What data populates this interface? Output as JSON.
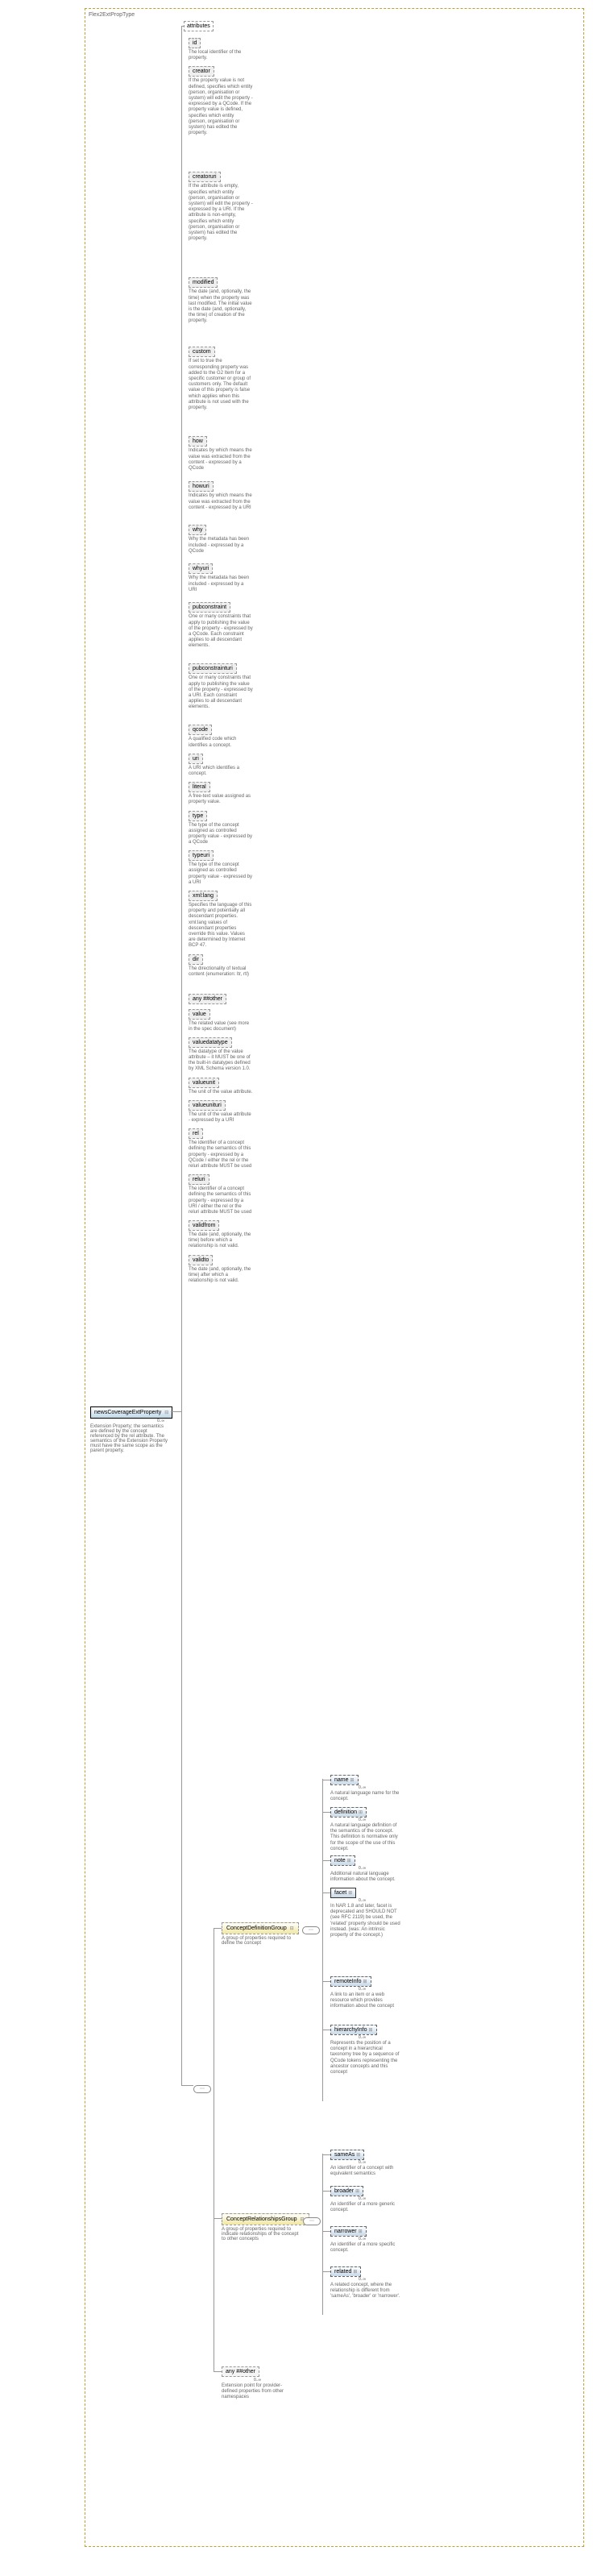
{
  "outer_title": "Flex2ExtPropType",
  "root": {
    "label": "newsCoverageExtProperty",
    "occ": "0..∞"
  },
  "root_note": "Extension Property; the semantics are defined by the concept referenced by the rel attribute. The semantics of the Extension Property must have the same scope as the parent property.",
  "attributes_label": "attributes",
  "attrs": [
    {
      "name": "id",
      "desc": "The local identifier of the property."
    },
    {
      "name": "creator",
      "desc": "If the property value is not defined, specifies which entity (person, organisation or system) will edit the property - expressed by a QCode. If the property value is defined, specifies which entity (person, organisation or system) has edited the property."
    },
    {
      "name": "creatoruri",
      "desc": "If the attribute is empty, specifies which entity (person, organisation or system) will edit the property - expressed by a URI. If the attribute is non-empty, specifies which entity (person, organisation or system) has edited the property."
    },
    {
      "name": "modified",
      "desc": "The date (and, optionally, the time) when the property was last modified. The initial value is the date (and, optionally, the time) of creation of the property."
    },
    {
      "name": "custom",
      "desc": "If set to true the corresponding property was added to the G2 Item for a specific customer or group of customers only. The default value of this property is false which applies when this attribute is not used with the property."
    },
    {
      "name": "how",
      "desc": "Indicates by which means the value was extracted from the content - expressed by a QCode"
    },
    {
      "name": "howuri",
      "desc": "Indicates by which means the value was extracted from the content - expressed by a URI"
    },
    {
      "name": "why",
      "desc": "Why the metadata has been included - expressed by a QCode"
    },
    {
      "name": "whyuri",
      "desc": "Why the metadata has been included - expressed by a URI"
    },
    {
      "name": "pubconstraint",
      "desc": "One or many constraints that apply to publishing the value of the property - expressed by a QCode. Each constraint applies to all descendant elements."
    },
    {
      "name": "pubconstrainturi",
      "desc": "One or many constraints that apply to publishing the value of the property - expressed by a URI. Each constraint applies to all descendant elements."
    },
    {
      "name": "qcode",
      "desc": "A qualified code which identifies a concept."
    },
    {
      "name": "uri",
      "desc": "A URI which identifies a concept."
    },
    {
      "name": "literal",
      "desc": "A free-text value assigned as property value."
    },
    {
      "name": "type",
      "desc": "The type of the concept assigned as controlled property value - expressed by a QCode"
    },
    {
      "name": "typeuri",
      "desc": "The type of the concept assigned as controlled property value - expressed by a URI"
    },
    {
      "name": "xml:lang",
      "desc": "Specifies the language of this property and potentially all descendant properties. xml:lang values of descendant properties override this value. Values are determined by Internet BCP 47."
    },
    {
      "name": "dir",
      "desc": "The directionality of textual content (enumeration: ltr, rtl)"
    },
    {
      "name": "any ##other",
      "desc": ""
    },
    {
      "name": "value",
      "desc": "The related value (see more in the spec document)"
    },
    {
      "name": "valuedatatype",
      "desc": "The datatype of the value attribute – it MUST be one of the built-in datatypes defined by XML Schema version 1.0."
    },
    {
      "name": "valueunit",
      "desc": "The unit of the value attribute."
    },
    {
      "name": "valueunituri",
      "desc": "The unit of the value attribute - expressed by a URI"
    },
    {
      "name": "rel",
      "desc": "The identifier of a concept defining the semantics of this property - expressed by a QCode / either the rel or the reluri attribute MUST be used"
    },
    {
      "name": "reluri",
      "desc": "The identifier of a concept defining the semantics of this property - expressed by a URI / either the rel or the reluri attribute MUST be used"
    },
    {
      "name": "validfrom",
      "desc": "The date (and, optionally, the time) before which a relationship is not valid."
    },
    {
      "name": "validto",
      "desc": "The date (and, optionally, the time) after which a relationship is not valid."
    }
  ],
  "cdg": {
    "label": "ConceptDefinitionGroup",
    "desc": "A group of properties required to define the concept",
    "children": [
      {
        "name": "name",
        "desc": "A natural language name for the concept."
      },
      {
        "name": "definition",
        "desc": "A natural language definition of the semantics of the concept. This definition is normative only for the scope of the use of this concept."
      },
      {
        "name": "note",
        "desc": "Additional natural language information about the concept."
      },
      {
        "name": "facet",
        "desc": "In NAR 1.8 and later, facet is deprecated and SHOULD NOT (see RFC 2119) be used, the 'related' property should be used instead. (was: An intrinsic property of the concept.)"
      },
      {
        "name": "remoteInfo",
        "desc": "A link to an item or a web resource which provides information about the concept"
      },
      {
        "name": "hierarchyInfo",
        "desc": "Represents the position of a concept in a hierarchical taxonomy tree by a sequence of QCode tokens representing the ancestor concepts and this concept"
      }
    ]
  },
  "crg": {
    "label": "ConceptRelationshipsGroup",
    "desc": "A group of properties required to indicate relationships of the concept to other concepts",
    "children": [
      {
        "name": "sameAs",
        "desc": "An identifier of a concept with equivalent semantics"
      },
      {
        "name": "broader",
        "desc": "An identifier of a more generic concept."
      },
      {
        "name": "narrower",
        "desc": "An identifier of a more specific concept."
      },
      {
        "name": "related",
        "desc": "A related concept, where the relationship is different from 'sameAs', 'broader' or 'narrower'."
      }
    ]
  },
  "any_other": {
    "label": "any ##other",
    "desc": "Extension point for provider-defined properties from other namespaces",
    "occ": "0..∞"
  }
}
